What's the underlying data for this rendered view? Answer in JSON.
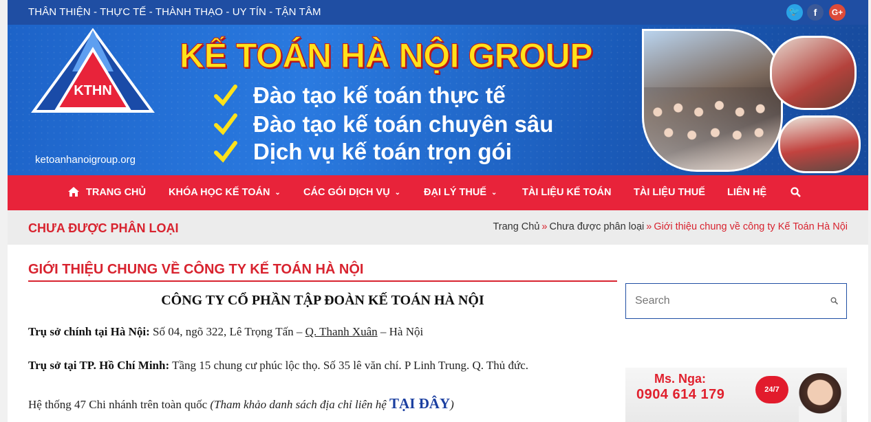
{
  "topbar": {
    "tagline": "THÂN THIỆN - THỰC TẾ - THÀNH THẠO - UY TÍN - TẬN TÂM",
    "social": {
      "twitter_glyph": "🐦",
      "facebook_glyph": "f",
      "google_glyph": "G+"
    }
  },
  "banner": {
    "logo_text": "KTHN",
    "url": "ketoanhanoigroup.org",
    "title": "KẾ TOÁN HÀ NỘI GROUP",
    "bullets": [
      "Đào tạo kế toán thực tế",
      "Đào tạo kế toán chuyên sâu",
      "Dịch vụ kế toán trọn gói"
    ]
  },
  "nav": {
    "items": [
      {
        "label": "TRANG CHỦ",
        "dropdown": false
      },
      {
        "label": "KHÓA HỌC KẾ TOÁN",
        "dropdown": true
      },
      {
        "label": "CÁC GÓI DỊCH VỤ",
        "dropdown": true
      },
      {
        "label": "ĐẠI LÝ THUẾ",
        "dropdown": true
      },
      {
        "label": "TÀI LIỆU KẾ TOÁN",
        "dropdown": false
      },
      {
        "label": "TÀI LIỆU THUẾ",
        "dropdown": false
      },
      {
        "label": "LIÊN HỆ",
        "dropdown": false
      }
    ],
    "caret": "⌄"
  },
  "breadcrumb": {
    "category_title": "CHƯA ĐƯỢC PHÂN LOẠI",
    "items": [
      "Trang Chủ",
      "Chưa được phân loại",
      "Giới thiệu chung về công ty Kế Toán Hà Nội"
    ],
    "separator": "»"
  },
  "post": {
    "title": "GIỚI THIỆU CHUNG VỀ CÔNG TY KẾ TOÁN HÀ NỘI",
    "company": "CÔNG TY CỔ PHẦN TẬP ĐOÀN KẾ TOÁN HÀ NỘI",
    "hq_label": "Trụ sở chính tại Hà Nội:",
    "hq_text_1": " Số 04,  ngõ 322, Lê Trọng Tấn – ",
    "hq_link": "Q. Thanh Xuân",
    "hq_text_2": " – Hà Nội",
    "hcm_label": "Trụ sở tại TP. Hồ Chí Minh:",
    "hcm_text": " Tầng 15 chung cư phúc lộc thọ. Số 35 lê văn chí. P Linh Trung. Q. Thủ đức.",
    "branches_text": "Hệ thống 47 Chi nhánh trên toàn quốc ",
    "branches_italic": "(Tham khảo danh sách địa chỉ liên hệ ",
    "branches_link": "TẠI ĐÂY",
    "branches_close": ")"
  },
  "sidebar": {
    "search_placeholder": "Search",
    "contact_name": "Ms. Nga:",
    "contact_phone": "0904 614 179",
    "badge": "24/7"
  },
  "colors": {
    "brand_blue": "#1f4ea3",
    "brand_red": "#e8233a",
    "title_red": "#d8232f",
    "banner_yellow": "#ffe21a"
  }
}
